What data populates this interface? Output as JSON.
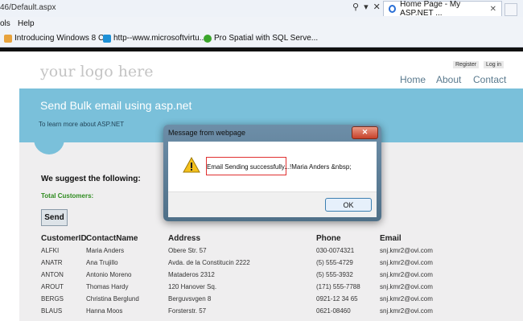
{
  "browser": {
    "url": "46/Default.aspx",
    "search_icon": "search-icon",
    "tab_title": "Home Page - My ASP.NET ...",
    "tab_close": "✕",
    "menu": [
      "ols",
      "Help"
    ],
    "favorites": [
      {
        "label": "Introducing Windows 8  C...",
        "icon_color": "#e8a33d"
      },
      {
        "label": "http--www.microsoftvirtu...",
        "icon_color": "#1e90d6"
      },
      {
        "label": "Pro Spatial with SQL Serve...",
        "icon_color": "#3aa52b"
      }
    ]
  },
  "header": {
    "logo": "your logo here",
    "register": "Register",
    "login": "Log in",
    "nav": [
      "Home",
      "About",
      "Contact"
    ]
  },
  "featured": {
    "heading": "Send Bulk email using asp.net",
    "subtext": "To learn more about ASP.NET"
  },
  "main": {
    "suggest_heading": "We suggest the following:",
    "total_label": "Total Customers:",
    "send_label": "Send"
  },
  "grid": {
    "headers": [
      "CustomerID",
      "ContactName",
      "Address",
      "Phone",
      "Email"
    ],
    "rows": [
      [
        "ALFKI",
        "Maria Anders",
        "Obere Str. 57",
        "030-0074321",
        "snj.kmr2@ovi.com"
      ],
      [
        "ANATR",
        "Ana Trujillo",
        "Avda. de la Constitucin 2222",
        "(5) 555-4729",
        "snj.kmr2@ovi.com"
      ],
      [
        "ANTON",
        "Antonio Moreno",
        "Mataderos 2312",
        "(5) 555-3932",
        "snj.kmr2@ovi.com"
      ],
      [
        "AROUT",
        "Thomas Hardy",
        "120 Hanover Sq.",
        "(171) 555-7788",
        "snj.kmr2@ovi.com"
      ],
      [
        "BERGS",
        "Christina Berglund",
        "Berguvsvgen 8",
        "0921-12 34 65",
        "snj.kmr2@ovi.com"
      ],
      [
        "BLAUS",
        "Hanna Moos",
        "Forsterstr. 57",
        "0621-08460",
        "snj.kmr2@ovi.com"
      ]
    ]
  },
  "dialog": {
    "title": "Message from webpage",
    "close": "✕",
    "message": "Email Sending successfully...!Maria Anders &nbsp;",
    "ok_label": "OK",
    "icon": "warning-icon"
  },
  "colors": {
    "featured_band": "#7ac0da",
    "total_label": "#2e8b1f",
    "highlight_box": "#e03030"
  }
}
